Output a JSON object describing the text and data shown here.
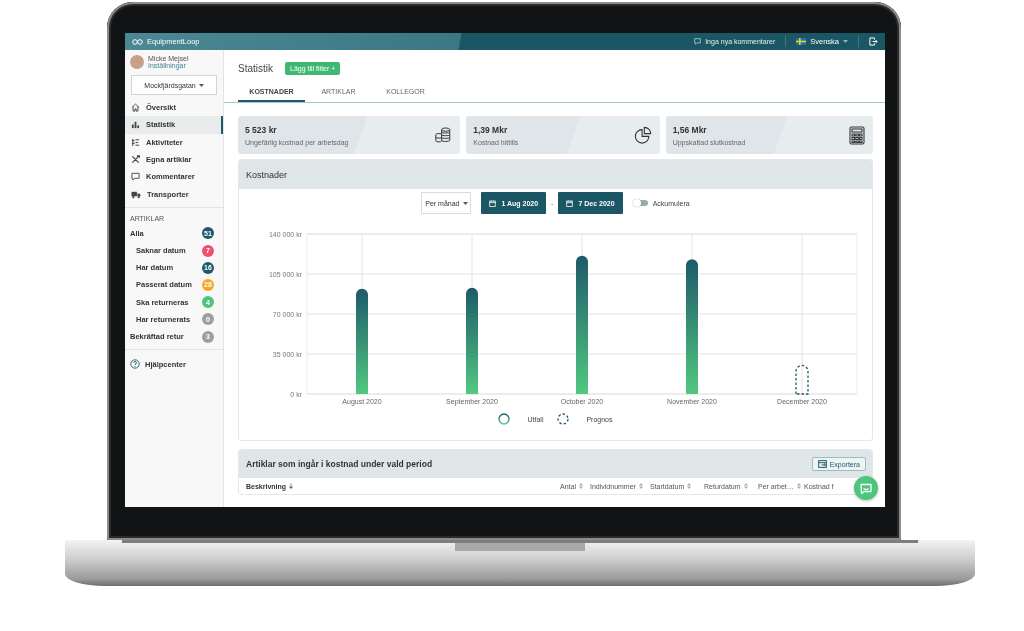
{
  "app": {
    "logo": "EquipmentLoop",
    "comments": "Inga nya kommentarer",
    "language": "Svenska"
  },
  "user": {
    "name": "Micke Mejsel",
    "settings": "Inställningar"
  },
  "location": "Mockfjärdsgatan",
  "nav": [
    {
      "label": "Översikt",
      "selected": false
    },
    {
      "label": "Statistik",
      "selected": true
    },
    {
      "label": "Aktiviteter",
      "selected": false
    },
    {
      "label": "Egna artiklar",
      "selected": false
    },
    {
      "label": "Kommentarer",
      "selected": false
    },
    {
      "label": "Transporter",
      "selected": false
    }
  ],
  "articles_heading": "ARTIKLAR",
  "article_filters": [
    {
      "label": "Alla",
      "count": "51",
      "color": "#1d5a6a",
      "children": [
        {
          "label": "Saknar datum",
          "count": "7",
          "color": "#f0506e"
        },
        {
          "label": "Har datum",
          "count": "16",
          "color": "#1d5a6a"
        },
        {
          "label": "Passerat datum",
          "count": "28",
          "color": "#f5a623"
        },
        {
          "label": "Ska returneras",
          "count": "4",
          "color": "#4cc57f"
        },
        {
          "label": "Har returnerats",
          "count": "0",
          "color": "#9e9e9e"
        }
      ]
    },
    {
      "label": "Bekräftad retur",
      "count": "3",
      "color": "#9e9e9e"
    }
  ],
  "help": "Hjälpcenter",
  "page": {
    "title": "Statistik",
    "filter_button": "Lägg till filter +"
  },
  "tabs": [
    {
      "label": "KOSTNADER",
      "selected": true
    },
    {
      "label": "ARTIKLAR",
      "selected": false
    },
    {
      "label": "KOLLEGOR",
      "selected": false
    }
  ],
  "stats": [
    {
      "value": "5 523 kr",
      "label": "Ungefärlig kostnad per arbetsdag"
    },
    {
      "value": "1,39 Mkr",
      "label": "Kostnad hittills"
    },
    {
      "value": "1,56 Mkr",
      "label": "Uppskattad slutkostnad"
    }
  ],
  "costs": {
    "title": "Kostnader",
    "period": "Per månad",
    "from": "1 Aug 2020",
    "separator": "-",
    "to": "7 Dec 2020",
    "accumulate": {
      "label": "Ackumulera",
      "on": false
    },
    "chart_data": {
      "type": "bar",
      "grid": true,
      "categories": [
        "August 2020",
        "September 2020",
        "October 2020",
        "November 2020",
        "December 2020"
      ],
      "series": [
        {
          "name": "Utfall",
          "color": "#1d5a6a",
          "values": [
            92000,
            93000,
            121000,
            118000,
            null
          ]
        },
        {
          "name": "Prognos",
          "color": "#1d5a6a",
          "values": [
            null,
            null,
            null,
            null,
            25000
          ]
        }
      ],
      "ylim": [
        0,
        140000
      ],
      "yticks": [
        {
          "value": 0,
          "label": "0 kr"
        },
        {
          "value": 35000,
          "label": "35 000 kr"
        },
        {
          "value": 70000,
          "label": "70 000 kr"
        },
        {
          "value": 105000,
          "label": "105 000 kr"
        },
        {
          "value": 140000,
          "label": "140 000 kr"
        }
      ]
    }
  },
  "articles_table": {
    "title": "Artiklar som ingår i kostnad under vald period",
    "export": "Exportera",
    "columns": [
      "Beskrivning",
      "Antal",
      "Individnummer",
      "Startdatum",
      "Returdatum",
      "Per arbet…",
      "Kostnad f"
    ]
  }
}
